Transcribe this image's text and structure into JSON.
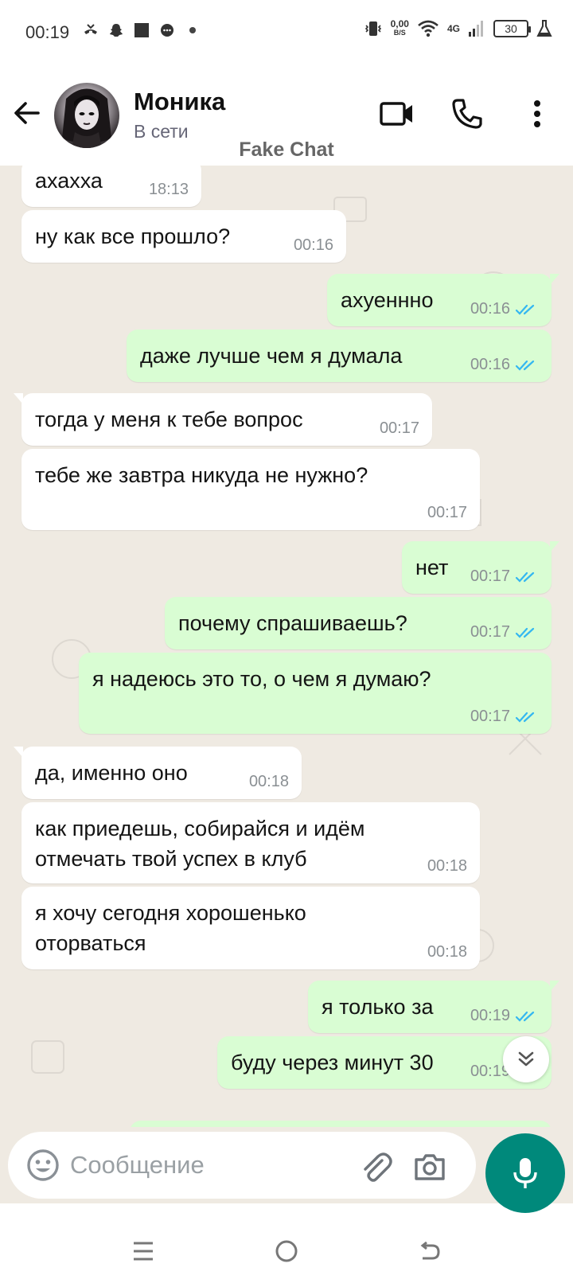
{
  "status_bar": {
    "time": "00:19",
    "net_speed_value": "0,00",
    "net_speed_unit": "B/S",
    "network_type": "4G",
    "battery": "30"
  },
  "header": {
    "contact_name": "Моника",
    "contact_status": "В сети",
    "watermark": "Fake Chat"
  },
  "messages": [
    {
      "dir": "in",
      "text": "ахахха",
      "time": "18:13"
    },
    {
      "dir": "in",
      "text": "ну как все прошло?",
      "time": "00:16"
    },
    {
      "dir": "out",
      "text": "ахуеннно",
      "time": "00:16",
      "read": true
    },
    {
      "dir": "out",
      "text": "даже лучше чем я думала",
      "time": "00:16",
      "read": true
    },
    {
      "dir": "in",
      "text": "тогда у меня к тебе вопрос",
      "time": "00:17"
    },
    {
      "dir": "in",
      "text": "тебе же завтра никуда не нужно?",
      "time": "00:17"
    },
    {
      "dir": "out",
      "text": "нет",
      "time": "00:17",
      "read": true
    },
    {
      "dir": "out",
      "text": "почему спрашиваешь?",
      "time": "00:17",
      "read": true
    },
    {
      "dir": "out",
      "text": "я надеюсь это то, о чем я думаю?",
      "time": "00:17",
      "read": true
    },
    {
      "dir": "in",
      "text": "да, именно оно",
      "time": "00:18"
    },
    {
      "dir": "in",
      "text": "как приедешь, собирайся и идём\nотмечать твой успех в клуб",
      "time": "00:18"
    },
    {
      "dir": "in",
      "text": "я хочу сегодня хорошенько\nоторваться",
      "time": "00:18"
    },
    {
      "dir": "out",
      "text": "я только за",
      "time": "00:19",
      "read": true
    },
    {
      "dir": "out",
      "text": "буду через минут 30",
      "time": "00:19",
      "read": true
    }
  ],
  "composer": {
    "placeholder": "Сообщение"
  },
  "colors": {
    "chat_bg": "#efeae2",
    "incoming_bubble": "#ffffff",
    "outgoing_bubble": "#d9fdd3",
    "read_ticks": "#34b7f1",
    "accent": "#00897b"
  },
  "icons": {
    "back": "arrow-left-icon",
    "video": "video-camera-icon",
    "call": "phone-icon",
    "menu": "more-vert-icon",
    "emoji": "emoji-icon",
    "attach": "paperclip-icon",
    "camera": "camera-icon",
    "mic": "microphone-icon",
    "scroll": "double-chevron-down-icon"
  }
}
